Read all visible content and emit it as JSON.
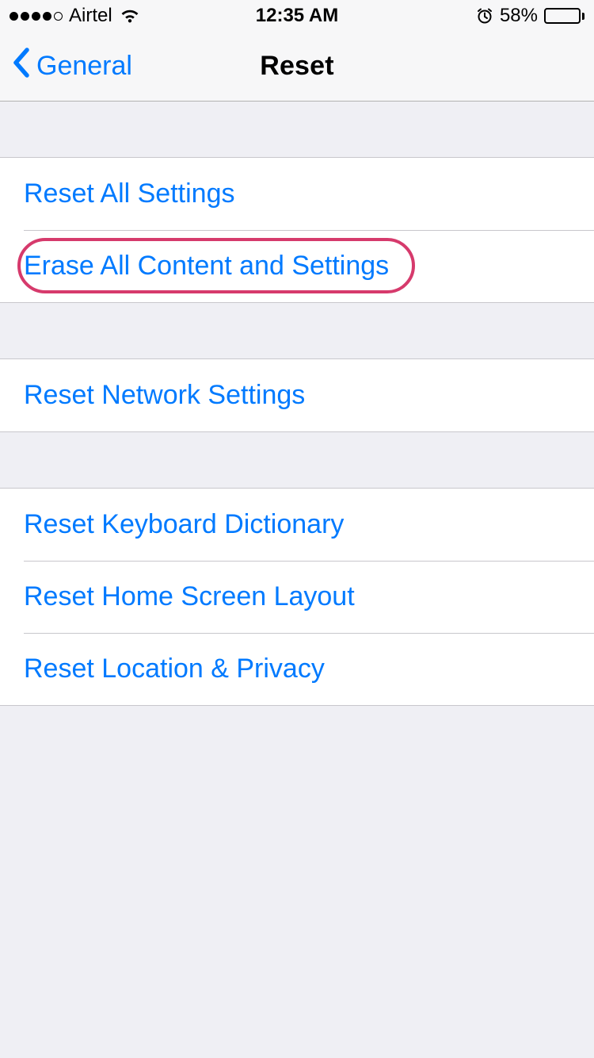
{
  "statusBar": {
    "carrier": "Airtel",
    "time": "12:35 AM",
    "batteryPct": "58%",
    "batteryFillPct": 58,
    "signalStrength": 4
  },
  "nav": {
    "back": "General",
    "title": "Reset"
  },
  "sections": [
    {
      "items": [
        {
          "label": "Reset All Settings",
          "highlight": false
        },
        {
          "label": "Erase All Content and Settings",
          "highlight": true
        }
      ]
    },
    {
      "items": [
        {
          "label": "Reset Network Settings",
          "highlight": false
        }
      ]
    },
    {
      "items": [
        {
          "label": "Reset Keyboard Dictionary",
          "highlight": false
        },
        {
          "label": "Reset Home Screen Layout",
          "highlight": false
        },
        {
          "label": "Reset Location & Privacy",
          "highlight": false
        }
      ]
    }
  ]
}
